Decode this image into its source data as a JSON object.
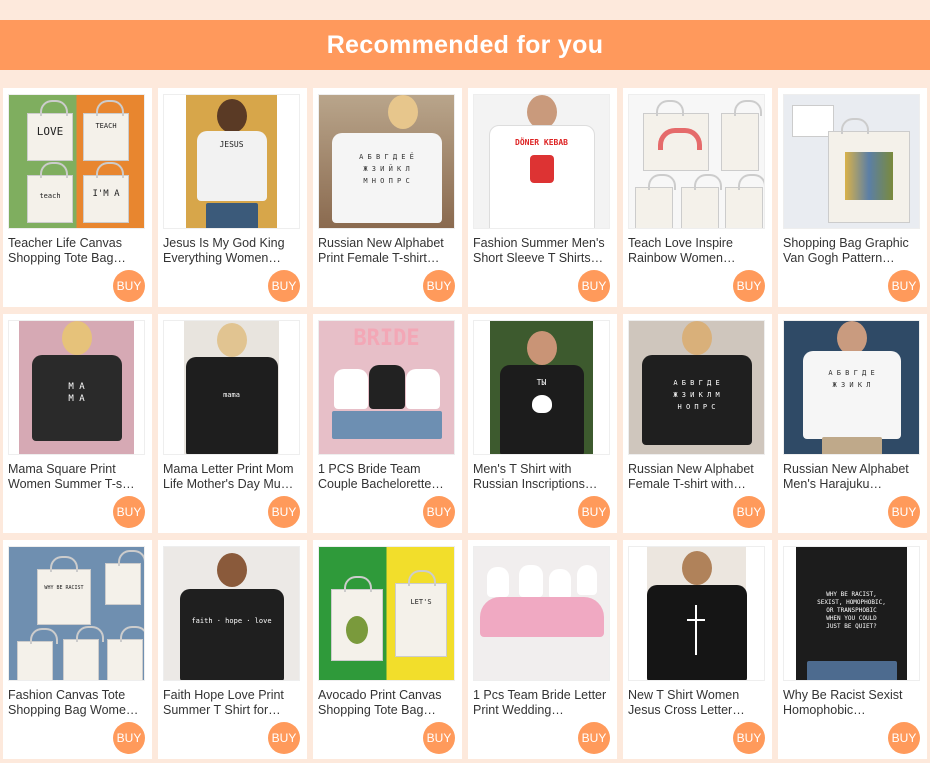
{
  "header": {
    "title": "Recommended for you"
  },
  "buy_label": "BUY",
  "accent_color": "#ff995c",
  "products": [
    {
      "title": "Teacher Life Canvas Shopping Tote Bag…",
      "image": "tote-bags-teacher"
    },
    {
      "title": "Jesus Is My God King Everything Women…",
      "image": "white-shirt-jesus"
    },
    {
      "title": "Russian New Alphabet Print Female T-shirt…",
      "image": "white-shirt-alphabet"
    },
    {
      "title": "Fashion Summer Men's Short Sleeve T Shirts…",
      "image": "white-shirt-doner-kebab"
    },
    {
      "title": "Teach Love Inspire Rainbow Women…",
      "image": "tote-bags-rainbow"
    },
    {
      "title": "Shopping Bag Graphic Van Gogh Pattern…",
      "image": "tote-bag-van-gogh"
    },
    {
      "title": "Mama Square Print Women Summer T-s…",
      "image": "black-shirt-mama"
    },
    {
      "title": "Mama Letter Print Mom Life Mother's Day Mu…",
      "image": "black-shirt-mama-script"
    },
    {
      "title": "1 PCS Bride Team Couple Bachelorette…",
      "image": "bride-team-group"
    },
    {
      "title": "Men's T Shirt with Russian Inscriptions…",
      "image": "black-shirt-russian-beard"
    },
    {
      "title": "Russian New Alphabet Female T-shirt with…",
      "image": "black-shirt-alphabet"
    },
    {
      "title": "Russian New Alphabet Men's Harajuku…",
      "image": "white-shirt-alphabet-men"
    },
    {
      "title": "Fashion Canvas Tote Shopping Bag Wome…",
      "image": "tote-bags-quotes"
    },
    {
      "title": "Faith Hope Love Print Summer T Shirt for…",
      "image": "black-shirt-faith"
    },
    {
      "title": "Avocado Print Canvas Shopping Tote Bag…",
      "image": "tote-bags-avocado"
    },
    {
      "title": "1 Pcs Team Bride Letter Print Wedding…",
      "image": "team-bride-dresses"
    },
    {
      "title": "New T Shirt Women Jesus Cross Letter…",
      "image": "black-shirt-jesus-cross"
    },
    {
      "title": "Why Be Racist Sexist Homophobic…",
      "image": "black-shirt-why-be-racist"
    }
  ]
}
